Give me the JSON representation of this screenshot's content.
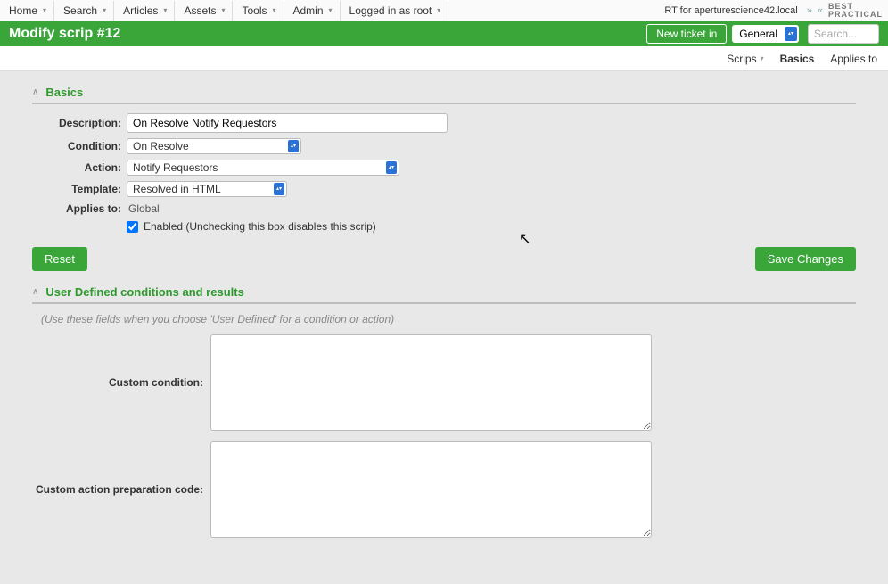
{
  "menubar": {
    "items": [
      "Home",
      "Search",
      "Articles",
      "Assets",
      "Tools",
      "Admin",
      "Logged in as root"
    ],
    "rt_label": "RT for aperturescience42.local",
    "logo_top": "BEST",
    "logo_bottom": "PRACTICAL"
  },
  "titlebar": {
    "title": "Modify scrip #12",
    "new_ticket_label": "New ticket in",
    "queue_selected": "General",
    "search_placeholder": "Search..."
  },
  "subnav": {
    "items": [
      {
        "label": "Scrips",
        "has_chevron": true,
        "active": false
      },
      {
        "label": "Basics",
        "has_chevron": false,
        "active": true
      },
      {
        "label": "Applies to",
        "has_chevron": false,
        "active": false
      }
    ]
  },
  "basics": {
    "section_title": "Basics",
    "labels": {
      "description": "Description",
      "condition": "Condition",
      "action": "Action",
      "template": "Template",
      "applies_to": "Applies to"
    },
    "description_value": "On Resolve Notify Requestors",
    "condition_value": "On Resolve",
    "action_value": "Notify Requestors",
    "template_value": "Resolved in HTML",
    "applies_to_value": "Global",
    "enabled_checked": true,
    "enabled_label": "Enabled (Unchecking this box disables this scrip)"
  },
  "buttons": {
    "reset": "Reset",
    "save": "Save Changes"
  },
  "udef": {
    "section_title": "User Defined conditions and results",
    "hint": "(Use these fields when you choose 'User Defined' for a condition or action)",
    "labels": {
      "custom_condition": "Custom condition",
      "custom_action_prep": "Custom action preparation code"
    },
    "custom_condition_value": "",
    "custom_action_prep_value": ""
  }
}
